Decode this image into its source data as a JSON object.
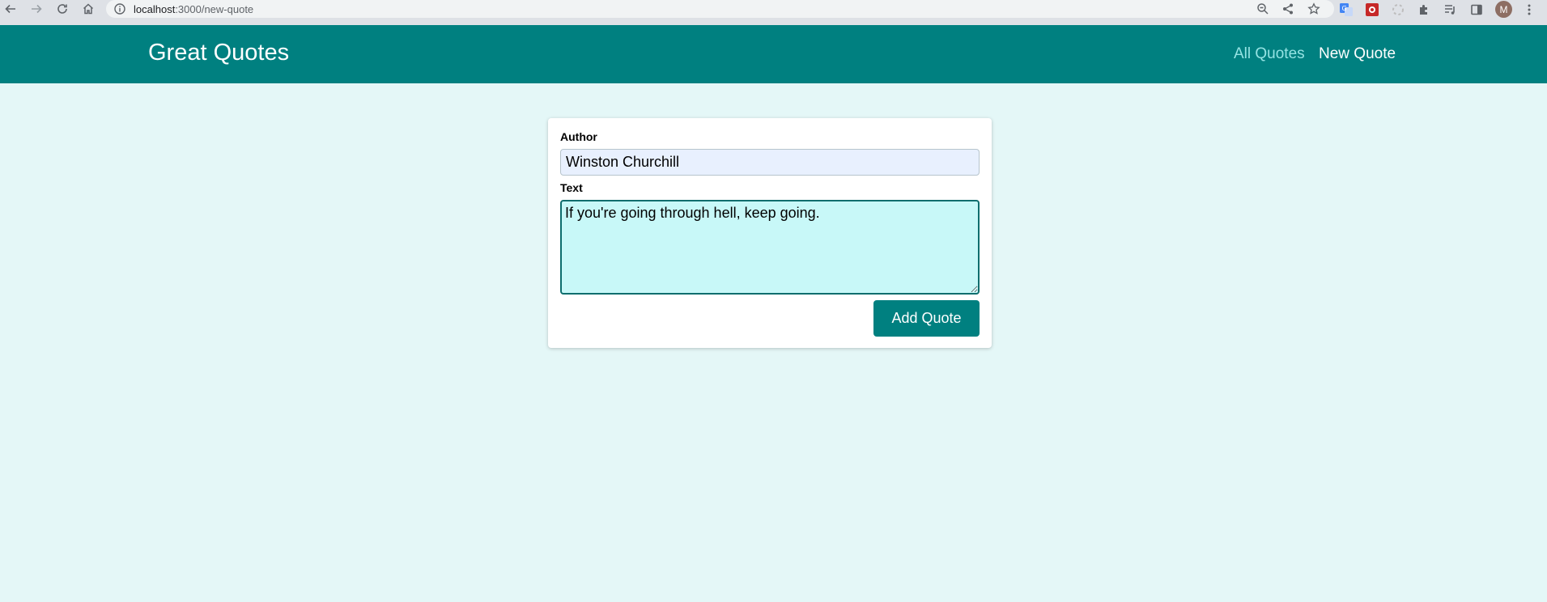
{
  "browser": {
    "url_host": "localhost",
    "url_path": ":3000/new-quote",
    "profile_initial": "M",
    "icons": [
      "back-icon",
      "forward-icon",
      "reload-icon",
      "home-icon",
      "info-icon",
      "zoom-icon",
      "share-icon",
      "star-icon",
      "translate-extension-icon",
      "red-extension-icon",
      "loading-extension-icon",
      "puzzle-icon",
      "media-icon",
      "sidepanel-icon",
      "menu-icon"
    ]
  },
  "header": {
    "brand": "Great Quotes",
    "nav": {
      "all_quotes": "All Quotes",
      "new_quote": "New Quote"
    },
    "colors": {
      "background": "#008080",
      "inactive_link": "#95e3e3",
      "active_link": "#ffffff"
    }
  },
  "form": {
    "author_label": "Author",
    "author_value": "Winston Churchill",
    "text_label": "Text",
    "text_value": "If you're going through hell, keep going.",
    "submit_label": "Add Quote"
  },
  "colors": {
    "page_background": "#e4f7f7",
    "accent": "#008080"
  }
}
